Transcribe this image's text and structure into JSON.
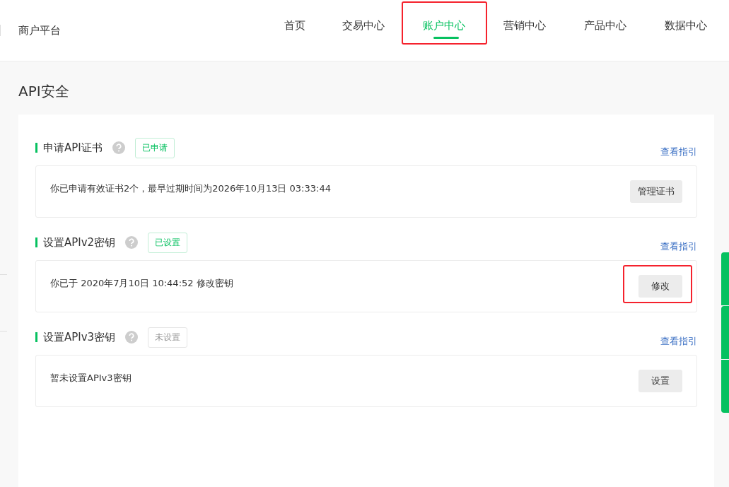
{
  "brand": "商户平台",
  "nav": [
    {
      "label": "首页",
      "selected": false,
      "highlighted": false
    },
    {
      "label": "交易中心",
      "selected": false,
      "highlighted": false
    },
    {
      "label": "账户中心",
      "selected": true,
      "highlighted": true
    },
    {
      "label": "营销中心",
      "selected": false,
      "highlighted": false
    },
    {
      "label": "产品中心",
      "selected": false,
      "highlighted": false
    },
    {
      "label": "数据中心",
      "selected": false,
      "highlighted": false
    }
  ],
  "page_title": "API安全",
  "sections": [
    {
      "title": "申请API证书",
      "status": {
        "label": "已申请",
        "kind": "done"
      },
      "link": "查看指引",
      "text": "你已申请有效证书2个，最早过期时间为2026年10月13日 03:33:44",
      "button": {
        "label": "管理证书",
        "highlighted": false
      }
    },
    {
      "title": "设置APIv2密钥",
      "status": {
        "label": "已设置",
        "kind": "done"
      },
      "link": "查看指引",
      "text": "你已于 2020年7月10日 10:44:52 修改密钥",
      "button": {
        "label": "修改",
        "highlighted": true
      }
    },
    {
      "title": "设置APIv3密钥",
      "status": {
        "label": "未设置",
        "kind": "none"
      },
      "link": "查看指引",
      "text": "暂未设置APIv3密钥",
      "button": {
        "label": "设置",
        "highlighted": false
      }
    }
  ]
}
